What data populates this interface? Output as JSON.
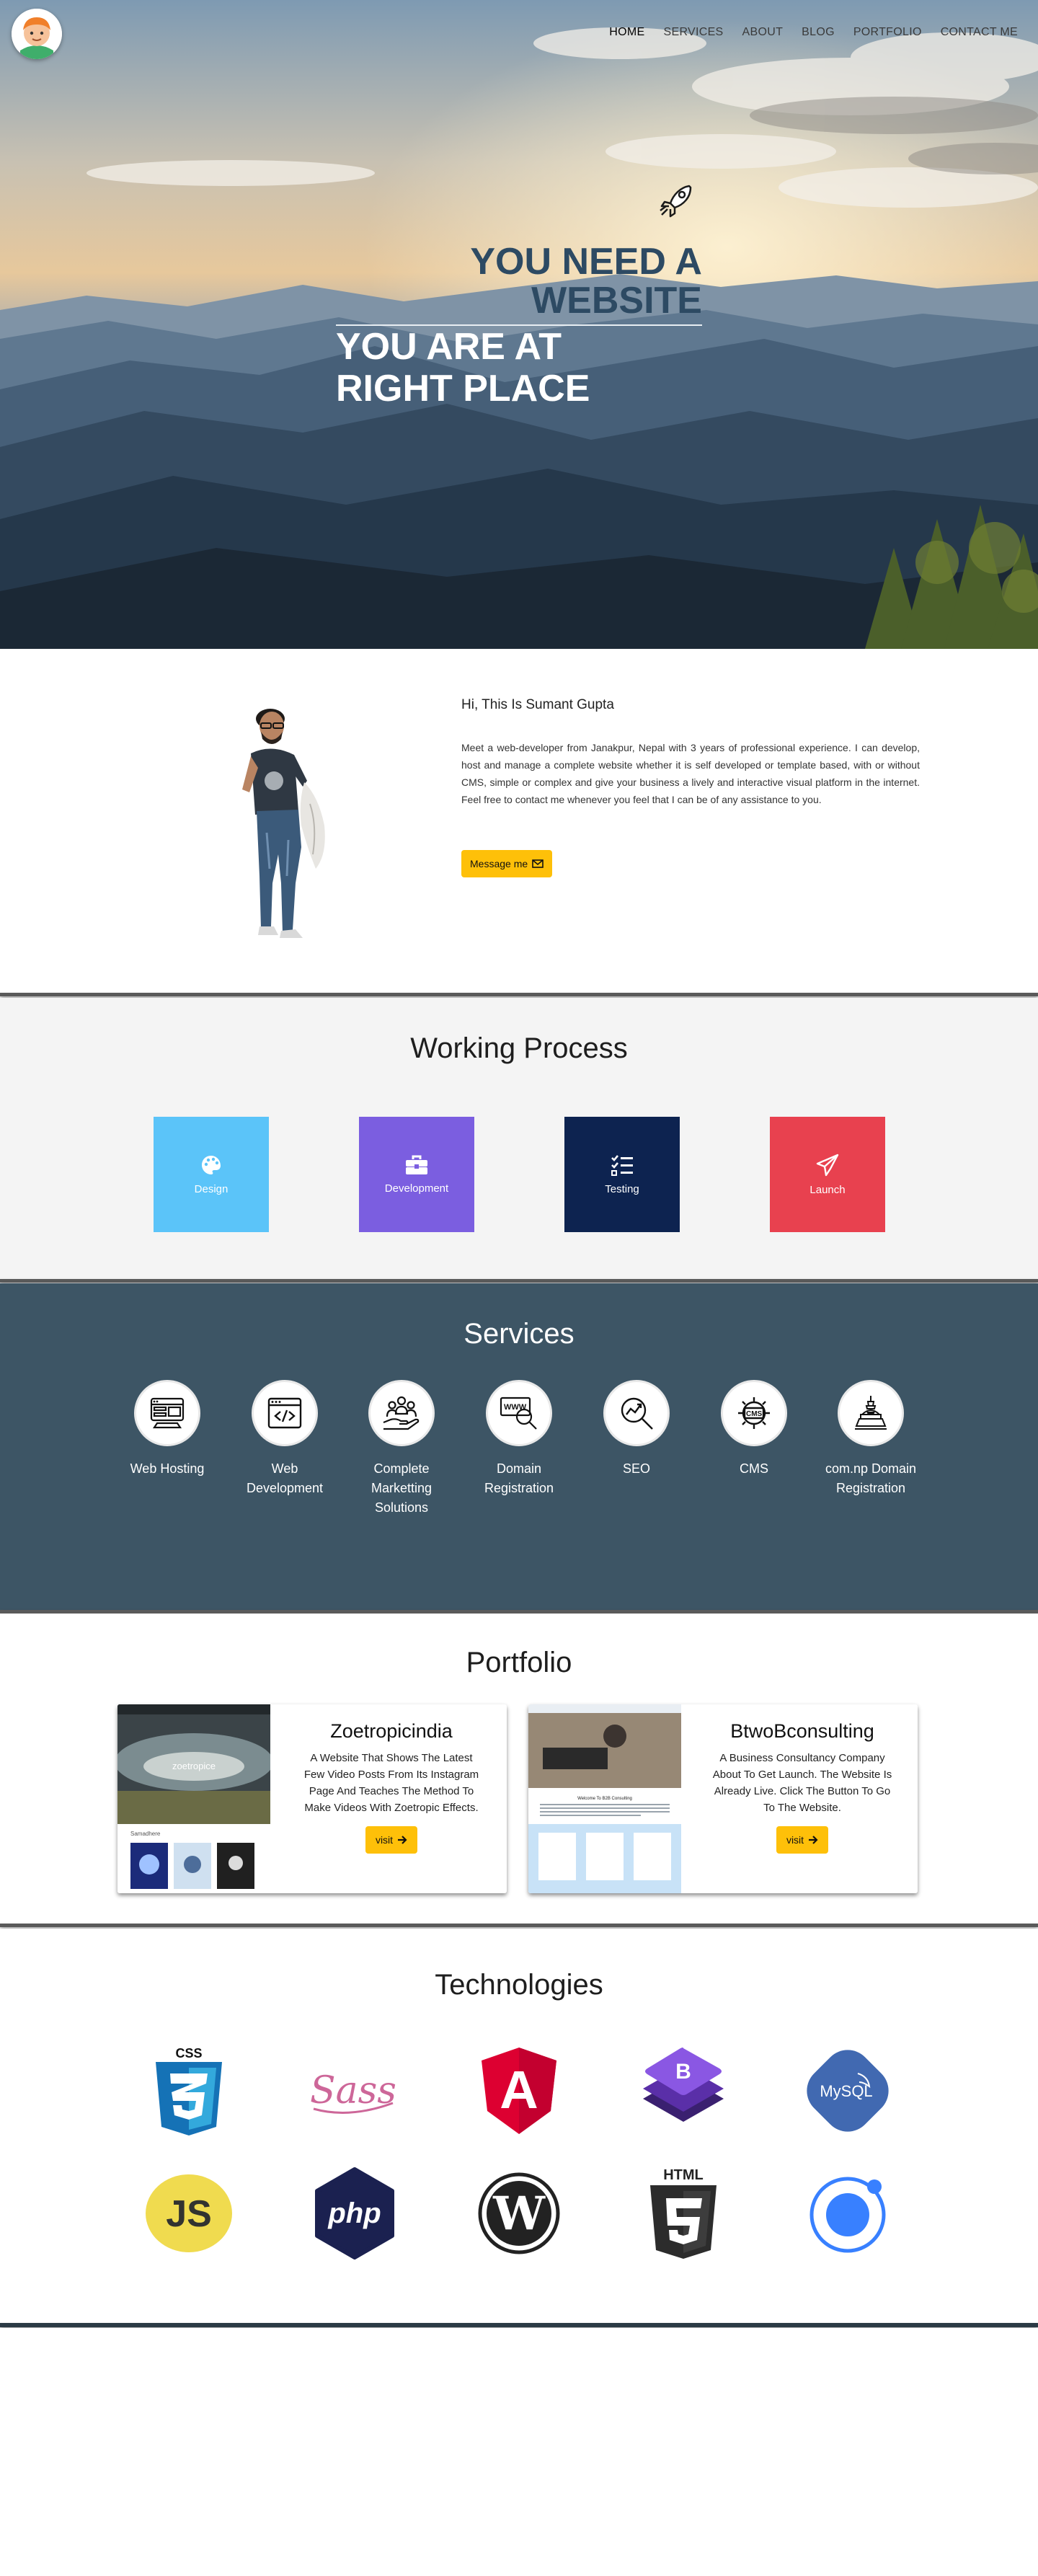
{
  "nav": {
    "items": [
      {
        "label": "HOME",
        "active": true
      },
      {
        "label": "SERVICES",
        "active": false
      },
      {
        "label": "ABOUT",
        "active": false
      },
      {
        "label": "BLOG",
        "active": false
      },
      {
        "label": "PORTFOLIO",
        "active": false
      },
      {
        "label": "CONTACT ME",
        "active": false
      }
    ]
  },
  "hero": {
    "line1": "YOU NEED A",
    "line2": "WEBSITE",
    "line3": "YOU ARE AT",
    "line4": "RIGHT PLACE"
  },
  "about": {
    "greeting": "Hi, This Is Sumant Gupta",
    "bio": "Meet a web-developer from Janakpur, Nepal with 3 years of professional experience. I can develop, host and manage a complete website whether it is self developed or template based, with or without CMS, simple or complex and give your business a lively and interactive visual platform in the internet. Feel free to contact me whenever you feel that I can be of any assistance to you.",
    "button_label": "Message me"
  },
  "process": {
    "title": "Working Process",
    "steps": [
      {
        "label": "Design",
        "color": "#5bc4f9",
        "icon": "palette-icon"
      },
      {
        "label": "Development",
        "color": "#7b5ee0",
        "icon": "toolbox-icon"
      },
      {
        "label": "Testing",
        "color": "#0d2350",
        "icon": "checklist-icon"
      },
      {
        "label": "Launch",
        "color": "#e8414f",
        "icon": "paper-plane-icon"
      }
    ]
  },
  "services": {
    "title": "Services",
    "items": [
      {
        "label": "Web Hosting",
        "icon": "server-icon"
      },
      {
        "label": "Web Development",
        "icon": "code-window-icon"
      },
      {
        "label": "Complete Marketting Solutions",
        "icon": "people-hand-icon"
      },
      {
        "label": "Domain Registration",
        "icon": "www-search-icon"
      },
      {
        "label": "SEO",
        "icon": "seo-magnifier-icon"
      },
      {
        "label": "CMS",
        "icon": "cms-gear-icon"
      },
      {
        "label": "com.np Domain Registration",
        "icon": "stupa-icon"
      }
    ]
  },
  "portfolio": {
    "title": "Portfolio",
    "projects": [
      {
        "name": "Zoetropicindia",
        "description": "A Website That Shows The Latest Few Video Posts From Its Instagram Page And Teaches The Method To Make Videos With Zoetropic Effects.",
        "button_label": "visit",
        "thumb_title": "zoetropice",
        "thumb_caption": "Samadhere"
      },
      {
        "name": "BtwoBconsulting",
        "description": "A Business Consultancy Company About To Get Launch. The Website Is Already Live. Click The Button To Go To The Website.",
        "button_label": "visit",
        "thumb_title": "Welcome To B2B Consulting"
      }
    ]
  },
  "tech": {
    "title": "Technologies",
    "logos": [
      {
        "name": "CSS3",
        "text": "CSS"
      },
      {
        "name": "Sass",
        "text": "Sass"
      },
      {
        "name": "Angular",
        "text": "A"
      },
      {
        "name": "Bootstrap",
        "text": "B"
      },
      {
        "name": "MySQL",
        "text": "MySQL"
      },
      {
        "name": "JavaScript",
        "text": "JS"
      },
      {
        "name": "PHP",
        "text": "php"
      },
      {
        "name": "WordPress",
        "text": "W"
      },
      {
        "name": "HTML5",
        "text": "HTML"
      },
      {
        "name": "Ionic",
        "text": ""
      }
    ]
  },
  "colors": {
    "accent": "#fec009",
    "services_bg": "#3d5565",
    "process_bg": "#f4f4f4"
  }
}
